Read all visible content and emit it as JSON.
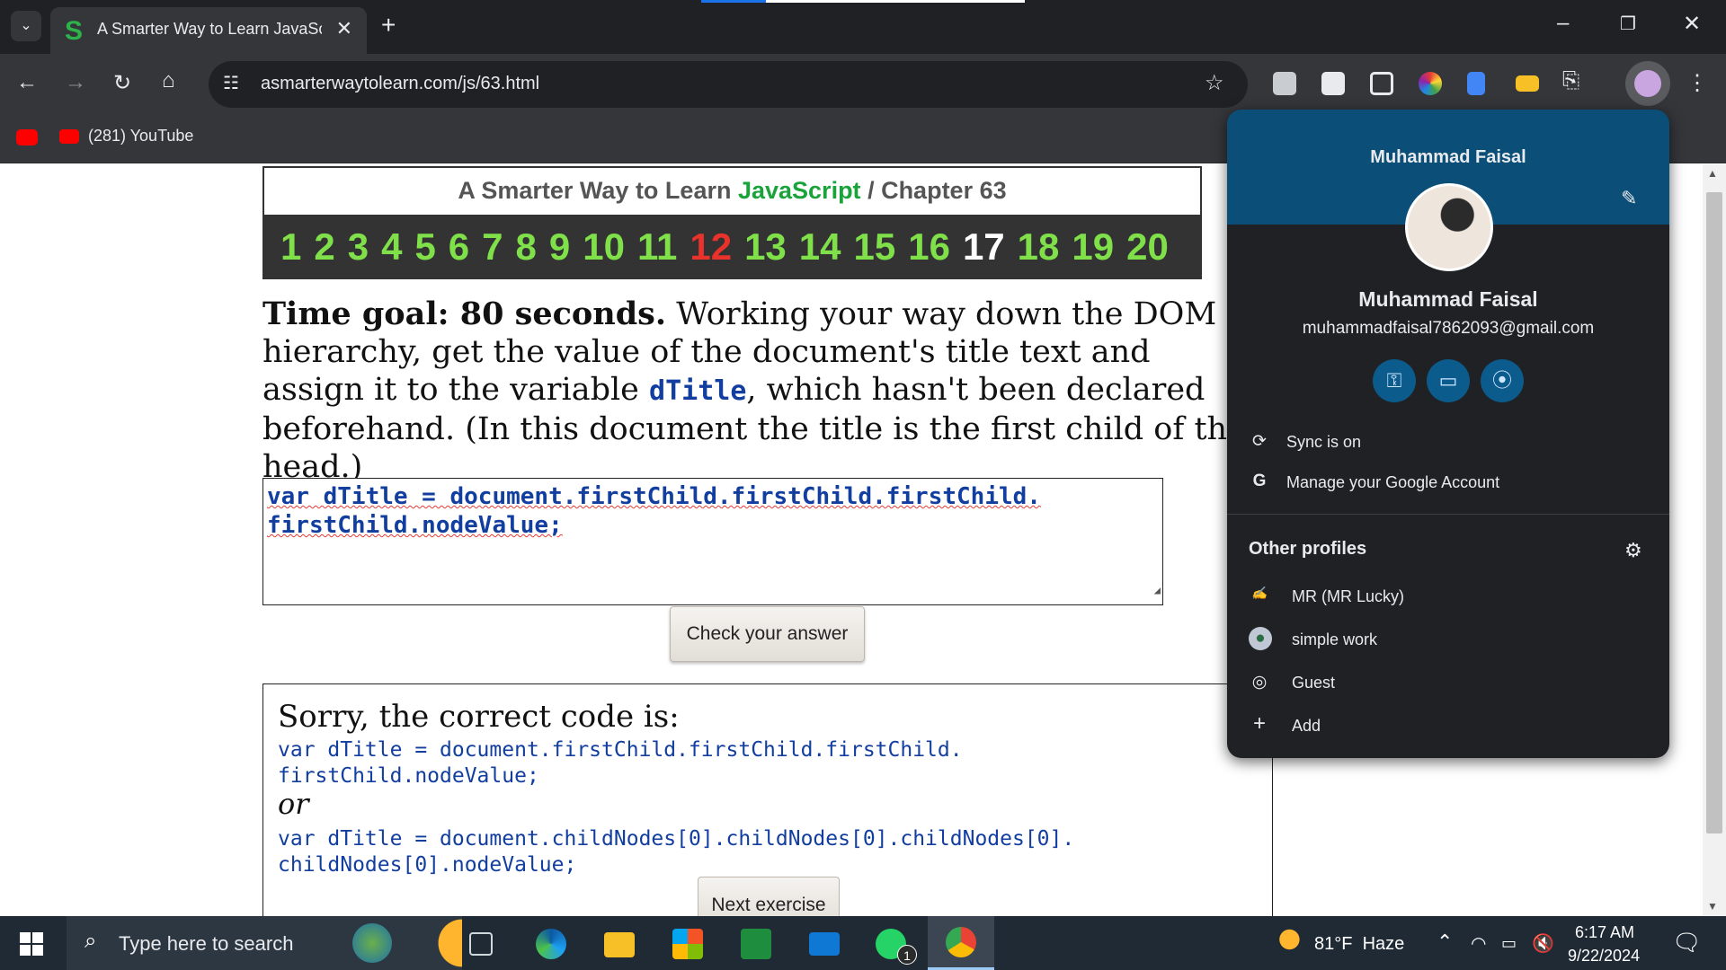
{
  "browser": {
    "tab_title": "A Smarter Way to Learn JavaScr",
    "tab_favicon": "S",
    "new_tab": "+",
    "url": "asmarterwaytolearn.com/js/63.html",
    "bookmark": "(281) YouTube"
  },
  "page": {
    "header_prefix": "A Smarter Way to Learn ",
    "header_js": "JavaScript",
    "header_suffix": "  /  Chapter 63",
    "chapters": [
      "1",
      "2",
      "3",
      "4",
      "5",
      "6",
      "7",
      "8",
      "9",
      "10",
      "11",
      "12",
      "13",
      "14",
      "15",
      "16",
      "17",
      "18",
      "19",
      "20"
    ],
    "goal_bold": "Time goal: 80 seconds.",
    "goal_text1": " Working your way down the DOM hierarchy, get the value of the document's title text and assign it to the variable ",
    "goal_code": "dTitle",
    "goal_text2": ", which hasn't been declared beforehand. (In this document the title is the first child of the head.)",
    "answer_line1": "var dTitle = document.firstChild.firstChild.firstChild.",
    "answer_line2": "firstChild.nodeValue;",
    "check_button": "Check your answer",
    "sorry": "Sorry, the correct code is:",
    "code1_line1": "var dTitle = document.firstChild.firstChild.firstChild.",
    "code1_line2": "firstChild.nodeValue;",
    "or": "or",
    "code2_line1": "var dTitle = document.childNodes[0].childNodes[0].childNodes[0].",
    "code2_line2": "childNodes[0].nodeValue;",
    "next_button": "Next exercise"
  },
  "profile": {
    "name_top": "Muhammad Faisal",
    "name": "Muhammad Faisal",
    "email": "muhammadfaisal7862093@gmail.com",
    "sync": "Sync is on",
    "manage": "Manage your Google Account",
    "other_profiles": "Other profiles",
    "profiles": [
      "MR (MR Lucky)",
      "simple work",
      "Guest",
      "Add"
    ]
  },
  "taskbar": {
    "search_placeholder": "Type here to search",
    "weather": "81°F  Haze",
    "time": "6:17 AM",
    "date": "9/22/2024",
    "whatsapp_badge": "1"
  },
  "colors": {
    "chapter_default": "#7fe04a",
    "chapter_current": "#e8322b",
    "chapter_visited": "#ffffff",
    "accent_blue": "#0b4f78"
  }
}
